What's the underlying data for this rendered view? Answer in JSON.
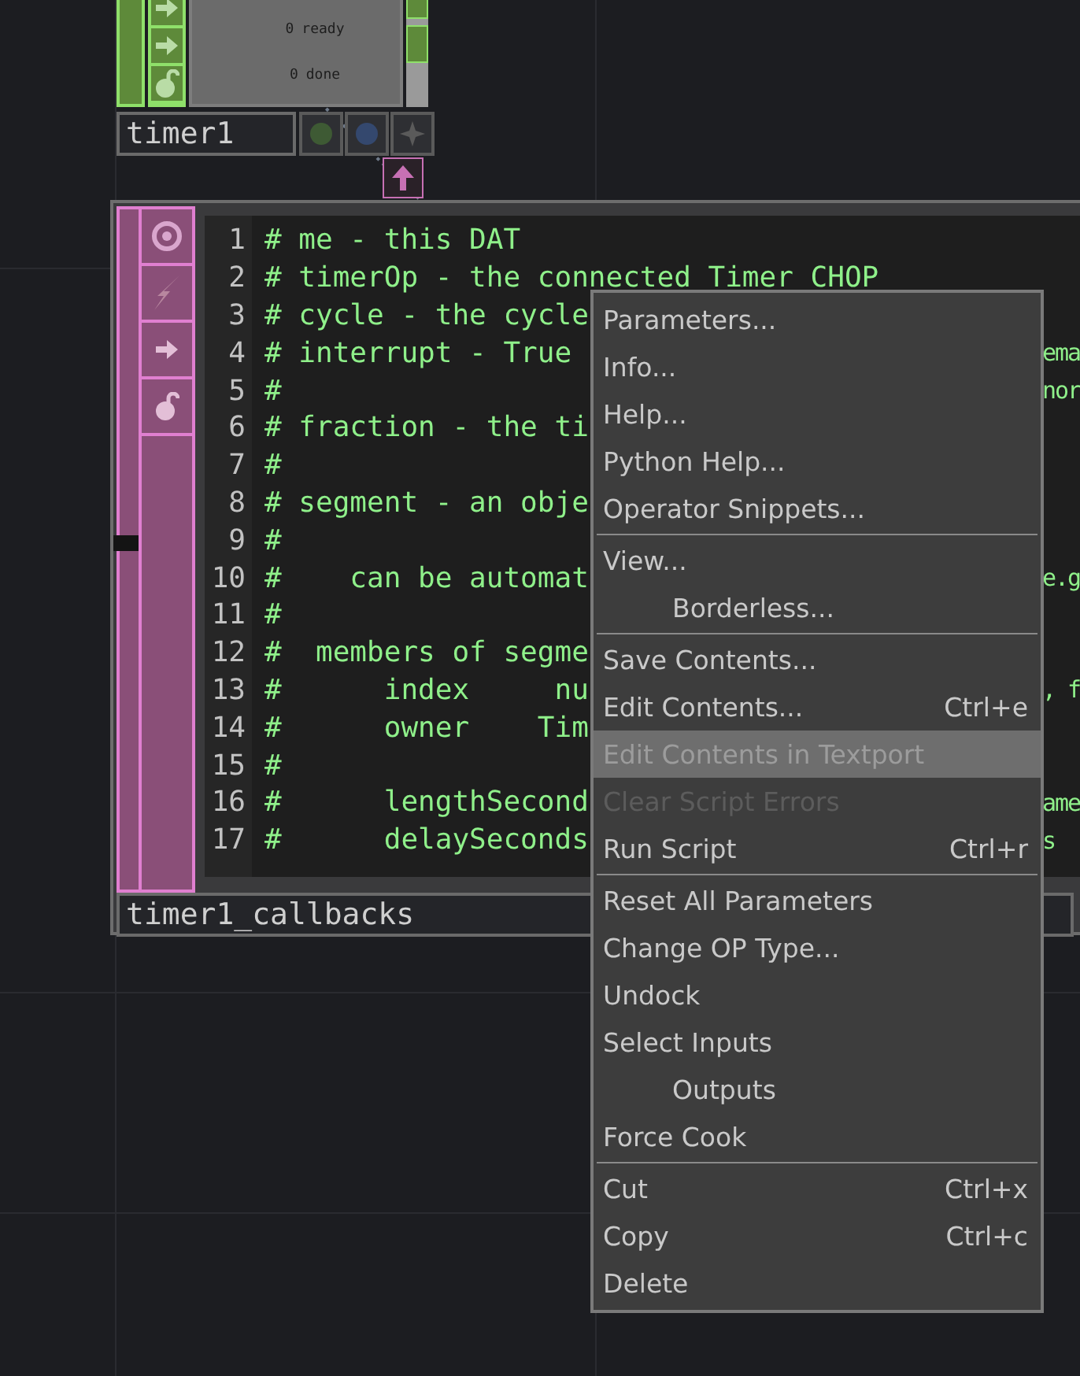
{
  "timer_node": {
    "name": "timer1",
    "readouts": [
      {
        "value": "0",
        "label": "ready"
      },
      {
        "value": "0",
        "label": "done"
      }
    ]
  },
  "callbacks_node": {
    "name": "timer1_callbacks",
    "lines": [
      {
        "number": "1",
        "text": "# me - this DAT"
      },
      {
        "number": "2",
        "text": "# timerOp - the connected Timer CHOP"
      },
      {
        "number": "3",
        "text": "# cycle - the cycle"
      },
      {
        "number": "4",
        "text": "# interrupt - True",
        "right_text": "ema"
      },
      {
        "number": "5",
        "text": "#",
        "right_text": "nor"
      },
      {
        "number": "6",
        "text": "# fraction - the ti"
      },
      {
        "number": "7",
        "text": "#"
      },
      {
        "number": "8",
        "text": "# segment - an obje"
      },
      {
        "number": "9",
        "text": "#"
      },
      {
        "number": "10",
        "text": "#    can be automat",
        "right_text": "e.g"
      },
      {
        "number": "11",
        "text": "#"
      },
      {
        "number": "12",
        "text": "#  members of segme"
      },
      {
        "number": "13",
        "text": "#      index     nu",
        "right_text": ", f"
      },
      {
        "number": "14",
        "text": "#      owner    Tim"
      },
      {
        "number": "15",
        "text": "#"
      },
      {
        "number": "16",
        "text": "#      lengthSecond",
        "right_text": "ame"
      },
      {
        "number": "17",
        "text": "#      delaySeconds",
        "right_text": "s"
      }
    ]
  },
  "context_menu": {
    "items": [
      {
        "kind": "item",
        "label": "Parameters...",
        "disabled": false,
        "selected": false,
        "indented": false
      },
      {
        "kind": "item",
        "label": "Info...",
        "disabled": false,
        "selected": false,
        "indented": false
      },
      {
        "kind": "item",
        "label": "Help...",
        "disabled": false,
        "selected": false,
        "indented": false
      },
      {
        "kind": "item",
        "label": "Python Help...",
        "disabled": false,
        "selected": false,
        "indented": false
      },
      {
        "kind": "item",
        "label": "Operator Snippets...",
        "disabled": false,
        "selected": false,
        "indented": false
      },
      {
        "kind": "separator"
      },
      {
        "kind": "item",
        "label": "View...",
        "disabled": false,
        "selected": false,
        "indented": false
      },
      {
        "kind": "item",
        "label": "Borderless...",
        "disabled": false,
        "selected": false,
        "indented": true
      },
      {
        "kind": "separator"
      },
      {
        "kind": "item",
        "label": "Save Contents...",
        "disabled": false,
        "selected": false,
        "indented": false
      },
      {
        "kind": "item",
        "label": "Edit Contents...",
        "shortcut": "Ctrl+e",
        "disabled": false,
        "selected": false,
        "indented": false
      },
      {
        "kind": "item",
        "label": "Edit Contents in Textport",
        "disabled": false,
        "selected": true,
        "indented": false
      },
      {
        "kind": "item",
        "label": "Clear Script Errors",
        "disabled": true,
        "selected": false,
        "indented": false
      },
      {
        "kind": "item",
        "label": "Run Script",
        "shortcut": "Ctrl+r",
        "disabled": false,
        "selected": false,
        "indented": false
      },
      {
        "kind": "separator"
      },
      {
        "kind": "item",
        "label": "Reset All Parameters",
        "disabled": false,
        "selected": false,
        "indented": false
      },
      {
        "kind": "item",
        "label": "Change OP Type...",
        "disabled": false,
        "selected": false,
        "indented": false
      },
      {
        "kind": "item",
        "label": "Undock",
        "disabled": false,
        "selected": false,
        "indented": false
      },
      {
        "kind": "item",
        "label": "Select Inputs",
        "disabled": false,
        "selected": false,
        "indented": false
      },
      {
        "kind": "item",
        "label": "Outputs",
        "disabled": false,
        "selected": false,
        "indented": true
      },
      {
        "kind": "item",
        "label": "Force Cook",
        "disabled": false,
        "selected": false,
        "indented": false
      },
      {
        "kind": "separator"
      },
      {
        "kind": "item",
        "label": "Cut",
        "shortcut": "Ctrl+x",
        "disabled": false,
        "selected": false,
        "indented": false
      },
      {
        "kind": "item",
        "label": "Copy",
        "shortcut": "Ctrl+c",
        "disabled": false,
        "selected": false,
        "indented": false
      },
      {
        "kind": "item",
        "label": "Delete",
        "disabled": false,
        "selected": false,
        "indented": false
      }
    ]
  }
}
